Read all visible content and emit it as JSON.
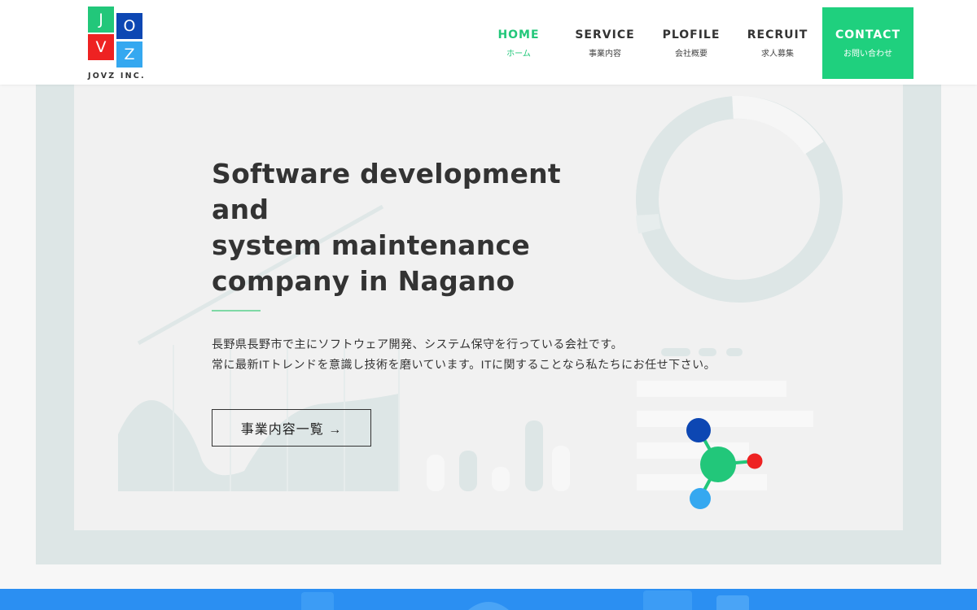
{
  "logo": {
    "letters": [
      "J",
      "O",
      "V",
      "Z"
    ],
    "company": "JOVZ INC.",
    "colors": {
      "j": "#22c77a",
      "o": "#0d47b3",
      "v": "#ee2222",
      "z": "#35a8f0"
    }
  },
  "nav": {
    "items": [
      {
        "en": "HOME",
        "ja": "ホーム",
        "active": true
      },
      {
        "en": "SERVICE",
        "ja": "事業内容"
      },
      {
        "en": "PLOFILE",
        "ja": "会社概要"
      },
      {
        "en": "RECRUIT",
        "ja": "求人募集"
      }
    ],
    "contact": {
      "en": "CONTACT",
      "ja": "お問い合わせ"
    }
  },
  "hero": {
    "title_lines": [
      "Software development",
      "and",
      "system maintenance",
      "company in Nagano"
    ],
    "description_lines": [
      "長野県長野市で主にソフトウェア開発、システム保守を行っている会社です。",
      "常に最新ITトレンドを意識し技術を磨いています。ITに関することなら私たちにお任せ下さい。"
    ],
    "button_label": "事業内容一覧 →"
  },
  "colors": {
    "accent_green": "#22c77a",
    "contact_green": "#1fd07e",
    "navy": "#0d47b3",
    "red": "#ee2222",
    "light_blue": "#35a8f0",
    "band_blue": "#2b8ff2"
  }
}
